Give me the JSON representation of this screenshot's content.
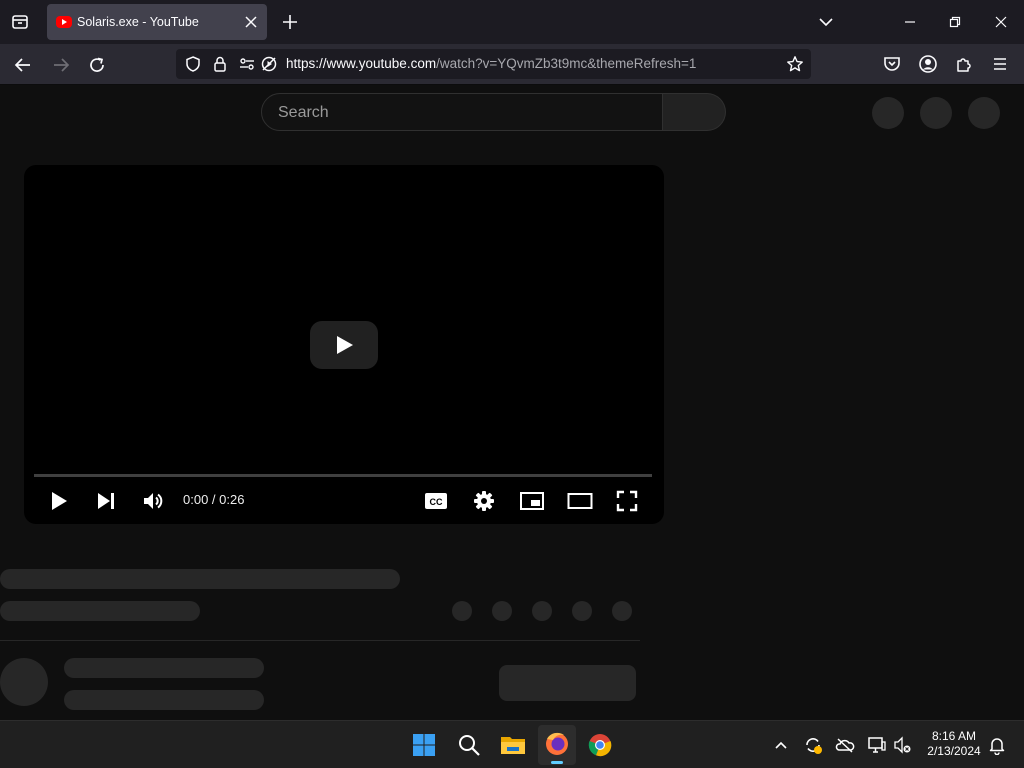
{
  "browser": {
    "tab_title": "Solaris.exe - YouTube",
    "url_host": "https://www.youtube.com",
    "url_path": "/watch?v=YQvmZb3t9mc&themeRefresh=1"
  },
  "youtube": {
    "search_placeholder": "Search",
    "player": {
      "time": "0:00 / 0:26",
      "progress": 0
    }
  },
  "taskbar": {
    "time": "8:16 AM",
    "date": "2/13/2024"
  },
  "colors": {
    "youtube_red": "#ff0000",
    "firefox_orange": "#ff7139",
    "windows_blue": "#3aa0f3"
  }
}
